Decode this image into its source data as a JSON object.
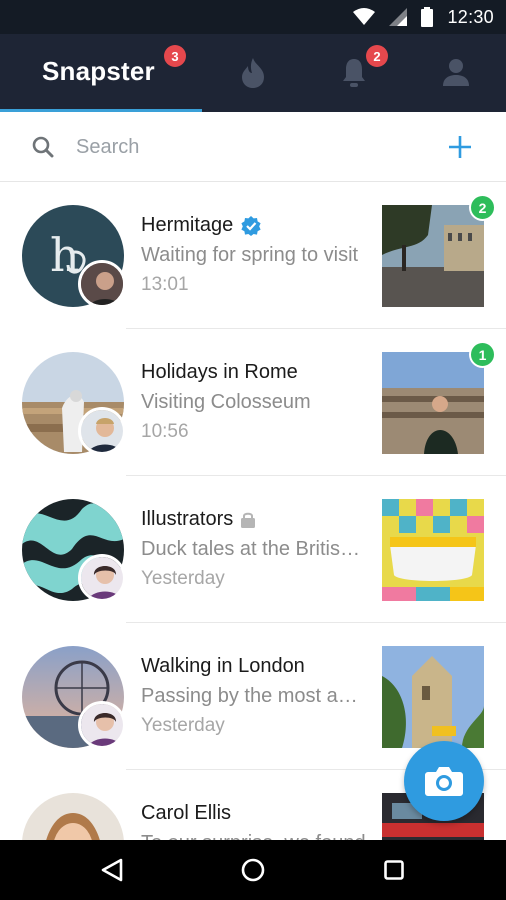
{
  "status_bar": {
    "time": "12:30"
  },
  "app_bar": {
    "title": "Snapster",
    "home_badge": "3",
    "notifications_badge": "2"
  },
  "search": {
    "placeholder": "Search"
  },
  "chats": [
    {
      "title": "Hermitage",
      "verified": true,
      "preview": "Waiting for spring to visit",
      "time": "13:01",
      "unread": "2"
    },
    {
      "title": "Holidays in Rome",
      "preview": "Visiting Colosseum",
      "time": "10:56",
      "unread": "1"
    },
    {
      "title": "Illustrators",
      "locked": true,
      "preview": "Duck tales at the British Museum",
      "time": "Yesterday"
    },
    {
      "title": "Walking in London",
      "preview": "Passing by the most amazing places",
      "time": "Yesterday"
    },
    {
      "title": "Carol Ellis",
      "preview": "To our surprise, we found"
    }
  ],
  "colors": {
    "status_bar": "#141b25",
    "app_bar": "#1e2535",
    "accent": "#2f9be0",
    "badge_red": "#e5484d",
    "badge_green": "#2ebd5b"
  },
  "icons": [
    "wifi-icon",
    "signal-icon",
    "battery-icon",
    "flame-icon",
    "bell-icon",
    "profile-icon",
    "search-icon",
    "plus-icon",
    "verified-icon",
    "lock-icon",
    "camera-icon",
    "back-icon",
    "home-icon",
    "recents-icon"
  ]
}
